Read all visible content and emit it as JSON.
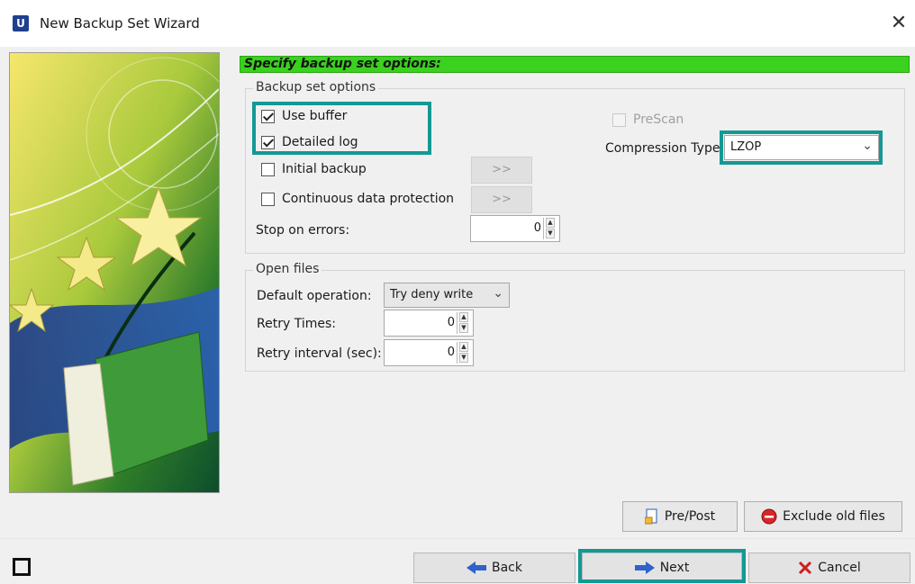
{
  "window": {
    "app_icon_letter": "U",
    "title": "New Backup Set Wizard",
    "close_glyph": "✕"
  },
  "heading": "Specify backup set options:",
  "backup_set_options": {
    "legend": "Backup set options",
    "use_buffer": {
      "label": "Use buffer",
      "checked": true
    },
    "detailed_log": {
      "label": "Detailed log",
      "checked": true
    },
    "initial_backup": {
      "label": "Initial backup",
      "checked": false,
      "button_label": ">>"
    },
    "continuous_data_protection": {
      "label": "Continuous data protection",
      "checked": false,
      "button_label": ">>"
    },
    "stop_on_errors": {
      "label": "Stop on errors:",
      "value": "0"
    },
    "prescan": {
      "label": "PreScan",
      "checked": false,
      "enabled": false
    },
    "compression_type": {
      "label": "Compression Type",
      "value": "LZOP"
    }
  },
  "open_files": {
    "legend": "Open files",
    "default_operation": {
      "label": "Default operation:",
      "value": "Try deny write"
    },
    "retry_times": {
      "label": "Retry Times:",
      "value": "0"
    },
    "retry_interval": {
      "label": "Retry interval (sec):",
      "value": "0"
    }
  },
  "action_buttons": {
    "pre_post": "Pre/Post",
    "exclude_old_files": "Exclude old files"
  },
  "nav_buttons": {
    "back": "Back",
    "next": "Next",
    "cancel": "Cancel"
  },
  "icons": {
    "app": "app-u-icon",
    "close": "close-icon",
    "pre_post": "document-icon",
    "exclude_old": "red-circle-icon",
    "back": "back-arrow-icon",
    "next": "next-arrow-icon",
    "cancel": "red-x-icon",
    "status": "window-square-icon"
  },
  "colors": {
    "heading_green": "#3ad11f",
    "highlight_teal": "#149894"
  }
}
